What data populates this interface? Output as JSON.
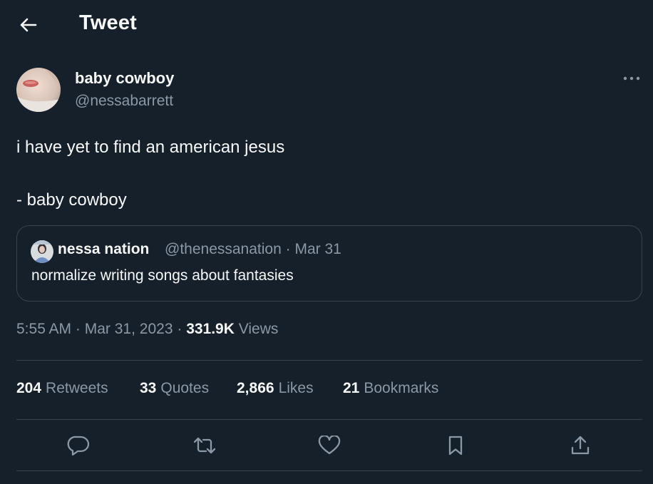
{
  "header": {
    "title": "Tweet",
    "back_icon": "arrow-left-icon"
  },
  "author": {
    "display_name": "baby cowboy",
    "handle": "@nessabarrett"
  },
  "tweet": {
    "text": "i have yet to find an american jesus\n\n- baby cowboy"
  },
  "quoted_tweet": {
    "display_name": "nessa nation",
    "handle": "@thenessanation",
    "separator": "·",
    "date": "Mar 31",
    "text": "normalize writing songs about fantasies"
  },
  "meta": {
    "time": "5:55 AM",
    "separator": "·",
    "date": "Mar 31, 2023",
    "views_count": "331.9K",
    "views_label": "Views"
  },
  "stats": [
    {
      "count": "204",
      "label": "Retweets"
    },
    {
      "count": "33",
      "label": "Quotes"
    },
    {
      "count": "2,866",
      "label": "Likes"
    },
    {
      "count": "21",
      "label": "Bookmarks"
    }
  ],
  "actions": [
    "reply-icon",
    "retweet-icon",
    "like-icon",
    "bookmark-icon",
    "share-icon"
  ],
  "colors": {
    "background": "#15202b",
    "text": "#f7f9f9",
    "muted": "#8b98a5",
    "border": "#38444d"
  }
}
